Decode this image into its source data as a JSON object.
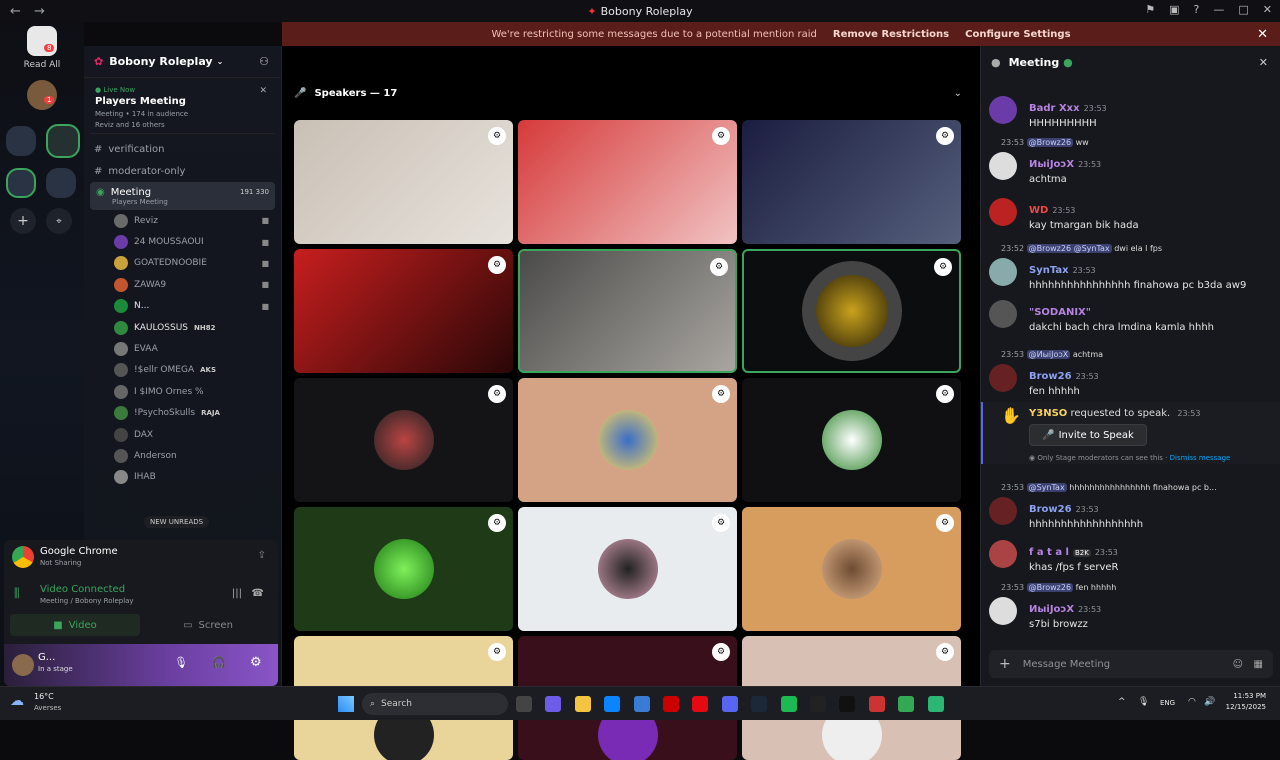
{
  "window": {
    "title": "Bobony Roleplay"
  },
  "banner": {
    "text": "We're restricting some messages due to a potential mention raid",
    "remove": "Remove Restrictions",
    "configure": "Configure Settings"
  },
  "rail": {
    "read_all": "Read All",
    "read_badge": "8",
    "dm_badge": "1"
  },
  "sidebar": {
    "guild_name": "Bobony Roleplay",
    "live": {
      "status": "Live Now",
      "title": "Players Meeting",
      "meta_channel": "Meeting",
      "audience": "174 in audience",
      "speakers": "Reviz and 16 others"
    },
    "channels": [
      "verification",
      "moderator-only"
    ],
    "active": {
      "name": "Meeting",
      "topic": "Players Meeting",
      "count_a": "191",
      "count_b": "330"
    },
    "members": [
      {
        "name": "Reviz",
        "color": "#9aa0a6",
        "cam": true
      },
      {
        "name": "24 MOUSSAOUI",
        "color": "#9aa0a6",
        "cam": true
      },
      {
        "name": "GOATEDNOOBIE",
        "color": "#9aa0a6",
        "cam": true
      },
      {
        "name": "ZAWA9",
        "color": "#9aa0a6",
        "cam": true
      },
      {
        "name": "N...",
        "color": "#e6e6e6",
        "cam": true
      },
      {
        "name": "KAULOSSUS",
        "tag": "NH82",
        "color": "#e6e6e6",
        "cam": false
      },
      {
        "name": "EVAA",
        "color": "#9aa0a6",
        "cam": false
      },
      {
        "name": "!$ellr OMEGA",
        "tag": "AKS",
        "color": "#9aa0a6",
        "cam": false
      },
      {
        "name": "I $IMO Ornes %",
        "color": "#9aa0a6",
        "cam": false
      },
      {
        "name": "!PsychoSkulls",
        "tag": "RAJA",
        "color": "#9aa0a6",
        "cam": false
      },
      {
        "name": "DAX",
        "color": "#9aa0a6",
        "cam": false
      },
      {
        "name": "Anderson",
        "color": "#9aa0a6",
        "cam": false
      },
      {
        "name": "IHAB",
        "color": "#9aa0a6",
        "cam": false
      }
    ],
    "new_unreads": "NEW UNREADS"
  },
  "panel": {
    "app": "Google Chrome",
    "app_status": "Not Sharing",
    "connected": "Video Connected",
    "connected_sub": "Meeting",
    "connected_server": "/ Bobony Roleplay",
    "video": "Video",
    "screen": "Screen",
    "user": "G...",
    "user_status": "In a stage"
  },
  "stage": {
    "header": "Speakers — 17"
  },
  "chat": {
    "title": "Meeting",
    "input_placeholder": "Message Meeting",
    "messages": [
      {
        "user": "Badr Xxx",
        "color": "#b783e0",
        "time": "23:53",
        "text": "HHHHHHHHH",
        "reply": "",
        "reply_to": ""
      },
      {
        "user": "ИыiJoɔX",
        "color": "#b783e0",
        "time": "23:53",
        "text": "achtma",
        "reply_to": "@Browz26",
        "reply": "ww",
        "reply_time": "23:53"
      },
      {
        "user": "WD",
        "color": "#f04747",
        "time": "23:53",
        "text": "kay tmargan bik hada",
        "reply": "",
        "reply_to": ""
      },
      {
        "user": "SynTax",
        "color": "#8ea1f0",
        "time": "23:53",
        "text": "hhhhhhhhhhhhhhhh finahowa pc b3da aw9",
        "reply_to": "@Browz26 @SynTax",
        "reply": "dwi ela l fps",
        "reply_time": "23:52"
      },
      {
        "user": "\"SODANIX\"",
        "color": "#b783e0",
        "time": "",
        "text": "dakchi bach chra lmdina kamla hhhh",
        "reply": "",
        "reply_to": ""
      },
      {
        "user": "Brow26",
        "color": "#8ea1f0",
        "time": "23:53",
        "text": "fen hhhhh",
        "reply_to": "@ИыiJoɔX",
        "reply": "achtma",
        "reply_time": "23:53"
      },
      {
        "user": "Brow26",
        "color": "#8ea1f0",
        "time": "23:53",
        "text": "hhhhhhhhhhhhhhhhhh",
        "reply_to": "@SynTax",
        "reply": "hhhhhhhhhhhhhhhh finahowa pc b...",
        "reply_time": "23:53"
      },
      {
        "user": "f a t a l",
        "color": "#b783e0",
        "time": "23:53",
        "text": "khas /fps f serveR",
        "reply": "",
        "reply_to": "",
        "tag": "B2K"
      },
      {
        "user": "ИыiJoɔX",
        "color": "#b783e0",
        "time": "23:53",
        "text": "s7bi browzz",
        "reply_to": "@Browz26",
        "reply": "fen hhhhh",
        "reply_time": "23:53"
      }
    ],
    "request": {
      "user": "Y3NSO",
      "text": "requested to speak.",
      "time": "23:53",
      "button": "Invite to Speak",
      "note": "Only Stage moderators can see this",
      "dismiss": "Dismiss message"
    }
  },
  "taskbar": {
    "weather": "16°C",
    "location": "Averses",
    "search": "Search",
    "lang": "ENG",
    "time": "11:53 PM",
    "date": "12/15/2025"
  },
  "colors": {
    "accent": "#3ba55d",
    "banner": "#5b1d19",
    "mention": "#3c4270"
  }
}
